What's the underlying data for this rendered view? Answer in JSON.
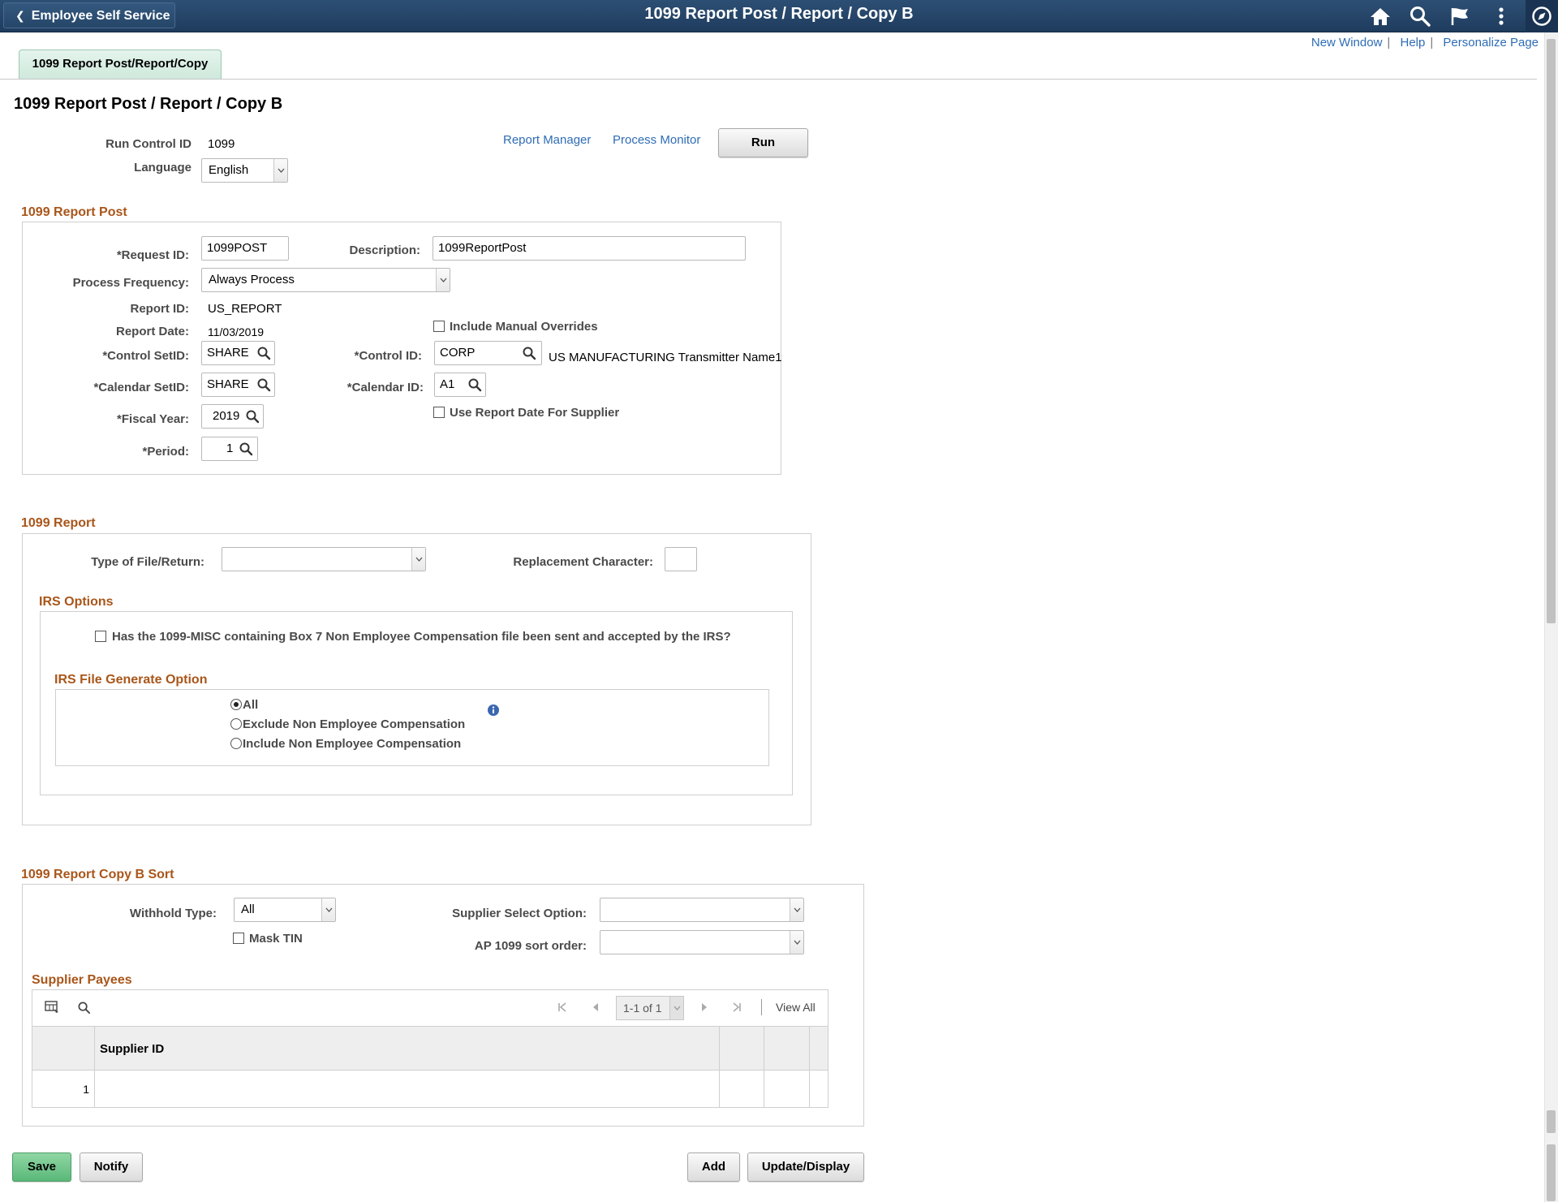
{
  "header": {
    "back_label": "Employee Self Service",
    "title": "1099 Report Post / Report / Copy B"
  },
  "top_links": {
    "new_window": "New Window",
    "help": "Help",
    "personalize": "Personalize Page",
    "separator": "|"
  },
  "tab": {
    "label": "1099 Report Post/Report/Copy"
  },
  "page_title": "1099 Report Post / Report / Copy B",
  "run_control": {
    "run_control_id_label": "Run Control ID",
    "run_control_id_value": "1099",
    "language_label": "Language",
    "language_value": "English",
    "report_manager": "Report Manager",
    "process_monitor": "Process Monitor",
    "run_button": "Run"
  },
  "report_post": {
    "section_title": "1099 Report Post",
    "request_id_label": "*Request ID:",
    "request_id_value": "1099POST",
    "description_label": "Description:",
    "description_value": "1099ReportPost",
    "process_frequency_label": "Process Frequency:",
    "process_frequency_value": "Always Process",
    "report_id_label": "Report ID:",
    "report_id_value": "US_REPORT",
    "report_date_label": "Report Date:",
    "report_date_value": "11/03/2019",
    "include_manual_overrides": "Include Manual Overrides",
    "control_setid_label": "*Control SetID:",
    "control_setid_value": "SHARE",
    "control_id_label": "*Control ID:",
    "control_id_value": "CORP",
    "control_id_desc": "US MANUFACTURING Transmitter Name1",
    "calendar_setid_label": "*Calendar SetID:",
    "calendar_setid_value": "SHARE",
    "calendar_id_label": "*Calendar ID:",
    "calendar_id_value": "A1",
    "use_report_date": "Use Report Date For Supplier",
    "fiscal_year_label": "*Fiscal Year:",
    "fiscal_year_value": "2019",
    "period_label": "*Period:",
    "period_value": "1"
  },
  "report": {
    "section_title": "1099 Report",
    "type_of_file_label": "Type of File/Return:",
    "type_of_file_value": "",
    "replacement_char_label": "Replacement Character:",
    "replacement_char_value": "",
    "irs_options_title": "IRS Options",
    "irs_question": "Has the 1099-MISC containing Box 7 Non Employee Compensation file been sent and accepted by the IRS?",
    "irs_file_option_title": "IRS File Generate Option",
    "options": [
      {
        "label": "All",
        "selected": true
      },
      {
        "label": "Exclude Non Employee Compensation",
        "selected": false
      },
      {
        "label": "Include Non Employee Compensation",
        "selected": false
      }
    ]
  },
  "copy_b": {
    "section_title": "1099 Report Copy B Sort",
    "withhold_type_label": "Withhold Type:",
    "withhold_type_value": "All",
    "mask_tin": "Mask TIN",
    "supplier_select_label": "Supplier Select Option:",
    "supplier_select_value": "",
    "ap_sort_label": "AP 1099 sort order:",
    "ap_sort_value": ""
  },
  "supplier_payees": {
    "title": "Supplier Payees",
    "pager": "1-1 of 1",
    "view_all": "View All",
    "column_supplier_id": "Supplier ID",
    "rows": [
      {
        "num": "1",
        "supplier_id": ""
      }
    ]
  },
  "footer": {
    "save": "Save",
    "notify": "Notify",
    "add": "Add",
    "update_display": "Update/Display"
  },
  "colors": {
    "header_bg": "#1f3c5e",
    "section_title": "#a9561a",
    "link": "#2e6cb5",
    "save_button": "#5ab879"
  }
}
